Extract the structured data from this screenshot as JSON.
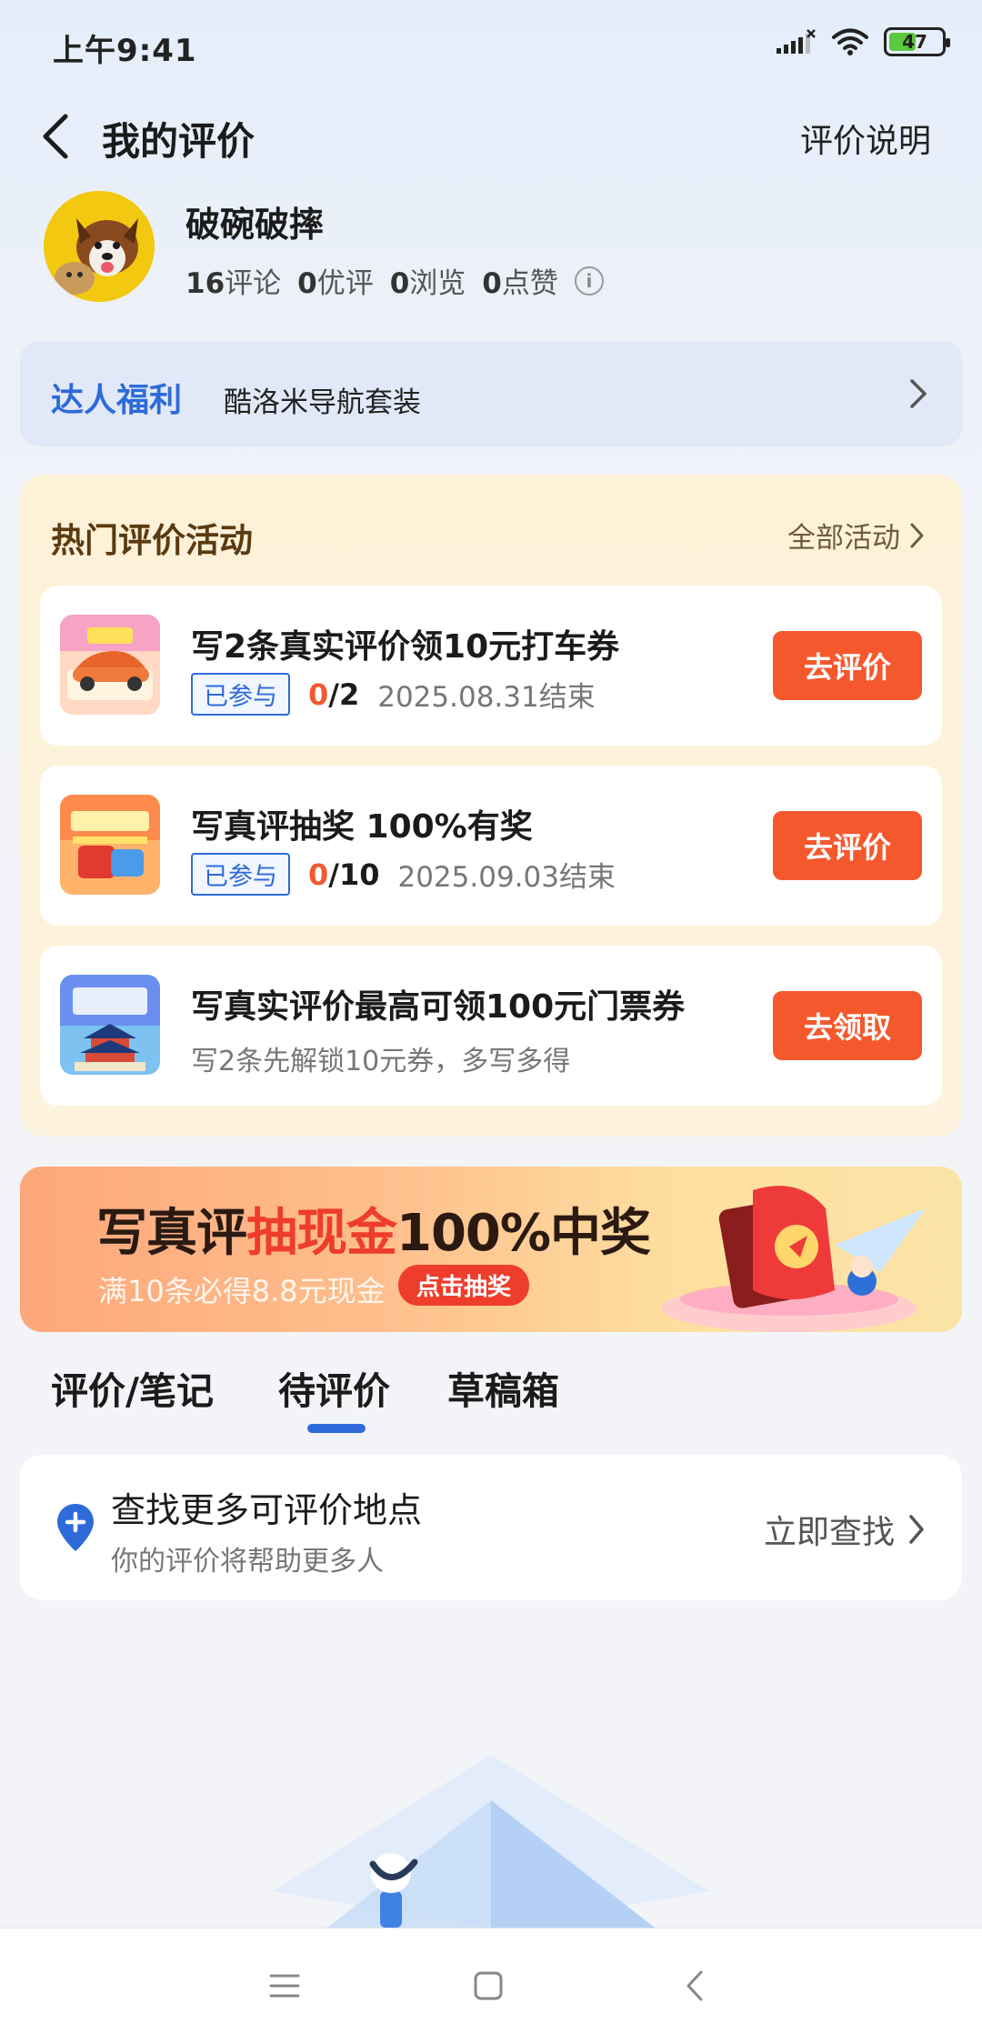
{
  "status_bar": {
    "time": "上午9:41",
    "battery": "47"
  },
  "header": {
    "title": "我的评价",
    "rules_link": "评价说明"
  },
  "profile": {
    "name": "破碗破摔",
    "stats": [
      {
        "value": "16",
        "label": "评论"
      },
      {
        "value": "0",
        "label": "优评"
      },
      {
        "value": "0",
        "label": "浏览"
      },
      {
        "value": "0",
        "label": "点赞"
      }
    ]
  },
  "perks": {
    "title": "达人福利",
    "desc": "酷洛米导航套装"
  },
  "activities": {
    "title": "热门评价活动",
    "all_link": "全部活动",
    "items": [
      {
        "title": "写2条真实评价领10元打车券",
        "badge": "已参与",
        "progress_current": "0",
        "progress_total": "/2",
        "end": "2025.08.31结束",
        "cta": "去评价"
      },
      {
        "title": "写真评抽奖 100%有奖",
        "badge": "已参与",
        "progress_current": "0",
        "progress_total": "/10",
        "end": "2025.09.03结束",
        "cta": "去评价"
      },
      {
        "title": "写真实评价最高可领100元门票券",
        "subtitle": "写2条先解锁10元券，多写多得",
        "cta": "去领取"
      }
    ]
  },
  "banner": {
    "title_a": "写真评",
    "title_hl": "抽现金",
    "title_b": "100%中奖",
    "subtitle": "满10条必得8.8元现金",
    "button": "点击抽奖"
  },
  "tabs": [
    {
      "label": "评价/笔记",
      "active": false
    },
    {
      "label": "待评价",
      "active": true
    },
    {
      "label": "草稿箱",
      "active": false
    }
  ],
  "find": {
    "title": "查找更多可评价地点",
    "subtitle": "你的评价将帮助更多人",
    "action": "立即查找"
  },
  "colors": {
    "accent_blue": "#2e6bd9",
    "cta_orange": "#f5582c",
    "progress_red": "#f05a30"
  }
}
